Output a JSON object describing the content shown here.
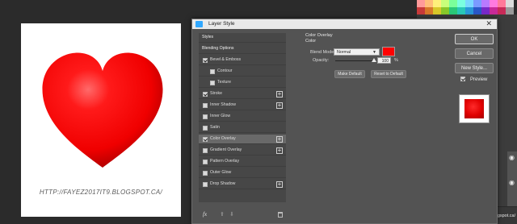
{
  "canvas": {
    "watermark": "HTTP://FAYEZ2017IT9.BLOGSPOT.CA/",
    "heart_color": "#ff0000"
  },
  "dialog": {
    "title": "Layer Style",
    "close_glyph": "✕",
    "styles": [
      {
        "label": "Styles",
        "checkbox": false,
        "checked": false,
        "plus": false,
        "section": true,
        "indent": 0
      },
      {
        "label": "Blending Options",
        "checkbox": false,
        "checked": false,
        "plus": false,
        "section": true,
        "indent": 0
      },
      {
        "label": "Bevel & Emboss",
        "checkbox": true,
        "checked": true,
        "plus": false,
        "section": false,
        "indent": 0
      },
      {
        "label": "Contour",
        "checkbox": true,
        "checked": false,
        "plus": false,
        "section": false,
        "indent": 1
      },
      {
        "label": "Texture",
        "checkbox": true,
        "checked": false,
        "plus": false,
        "section": false,
        "indent": 1
      },
      {
        "label": "Stroke",
        "checkbox": true,
        "checked": true,
        "plus": true,
        "section": false,
        "indent": 0
      },
      {
        "label": "Inner Shadow",
        "checkbox": true,
        "checked": false,
        "plus": true,
        "section": false,
        "indent": 0
      },
      {
        "label": "Inner Glow",
        "checkbox": true,
        "checked": false,
        "plus": false,
        "section": false,
        "indent": 0
      },
      {
        "label": "Satin",
        "checkbox": true,
        "checked": false,
        "plus": false,
        "section": false,
        "indent": 0
      },
      {
        "label": "Color Overlay",
        "checkbox": true,
        "checked": true,
        "plus": true,
        "section": false,
        "indent": 0,
        "selected": true
      },
      {
        "label": "Gradient Overlay",
        "checkbox": true,
        "checked": false,
        "plus": true,
        "section": false,
        "indent": 0
      },
      {
        "label": "Pattern Overlay",
        "checkbox": true,
        "checked": false,
        "plus": false,
        "section": false,
        "indent": 0
      },
      {
        "label": "Outer Glow",
        "checkbox": true,
        "checked": false,
        "plus": false,
        "section": false,
        "indent": 0
      },
      {
        "label": "Drop Shadow",
        "checkbox": true,
        "checked": false,
        "plus": true,
        "section": false,
        "indent": 0
      }
    ],
    "bottom_tools": {
      "fx": "fx",
      "up": "⬆",
      "down": "⬇"
    },
    "color_overlay": {
      "heading": "Color Overlay",
      "subheading": "Color",
      "blend_mode_label": "Blend Mode:",
      "blend_mode_value": "Normal",
      "overlay_color": "#ff0000",
      "opacity_label": "Opacity:",
      "opacity_value": "100",
      "opacity_fraction": 1.0,
      "opacity_unit": "%",
      "make_default": "Make Default",
      "reset_default": "Reset to Default"
    },
    "buttons": {
      "ok": "OK",
      "cancel": "Cancel",
      "new_style": "New Style...",
      "preview_label": "Preview",
      "preview_checked": true
    }
  },
  "layers": {
    "layer_type_glyph": "T",
    "layer_name": "http://fayez2017it9.blogspot.ca/",
    "eye_glyph": "👁"
  },
  "swatch_colors": [
    "#ff9a9a",
    "#ffbe7a",
    "#fff07a",
    "#c8ff7a",
    "#7aff9a",
    "#7affe0",
    "#7ad8ff",
    "#7a9aff",
    "#b87aff",
    "#ff7ae0",
    "#ff7a9a",
    "#dcdcdc",
    "#c83a3a",
    "#d8782a",
    "#d8c82a",
    "#88c82a",
    "#2ac878",
    "#2ac8b8",
    "#2a98d8",
    "#2a58c8",
    "#782ac8",
    "#c82a98",
    "#c82a58",
    "#9a9a9a"
  ]
}
